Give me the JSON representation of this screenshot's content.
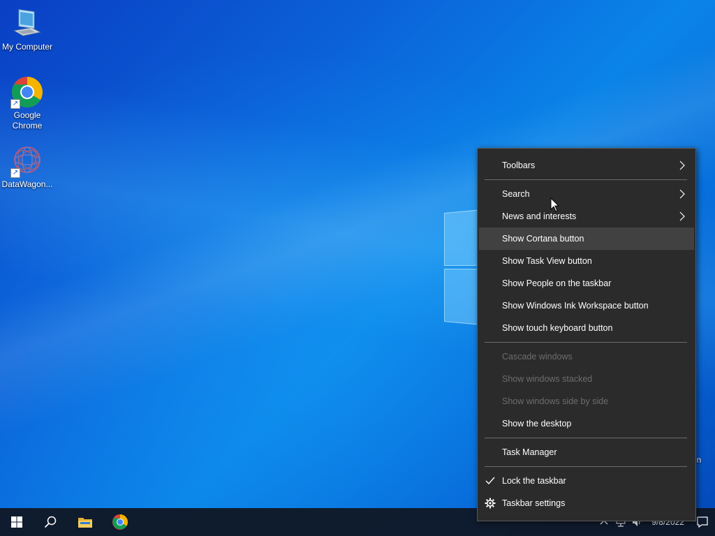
{
  "desktop": {
    "icons": [
      {
        "label": "My Computer",
        "icon": "computer-icon"
      },
      {
        "label": "Google Chrome",
        "icon": "chrome-icon"
      },
      {
        "label": "DataWagon...",
        "icon": "datawagon-icon"
      }
    ],
    "partial_text": "in"
  },
  "context_menu": {
    "items": [
      {
        "label": "Toolbars",
        "submenu": true
      },
      {
        "label": "Search",
        "submenu": true
      },
      {
        "label": "News and interests",
        "submenu": true
      },
      {
        "label": "Show Cortana button",
        "highlighted": true
      },
      {
        "label": "Show Task View button"
      },
      {
        "label": "Show People on the taskbar"
      },
      {
        "label": "Show Windows Ink Workspace button"
      },
      {
        "label": "Show touch keyboard button"
      },
      {
        "label": "Cascade windows",
        "disabled": true
      },
      {
        "label": "Show windows stacked",
        "disabled": true
      },
      {
        "label": "Show windows side by side",
        "disabled": true
      },
      {
        "label": "Show the desktop"
      },
      {
        "label": "Task Manager"
      },
      {
        "label": "Lock the taskbar",
        "checked": true
      },
      {
        "label": "Taskbar settings",
        "icon": "gear-icon"
      }
    ]
  },
  "taskbar": {
    "buttons": [
      "start-icon",
      "search-icon",
      "file-explorer-icon",
      "chrome-icon"
    ],
    "tray": {
      "date": "9/8/2022",
      "icons": [
        "chevron-up-icon",
        "network-icon",
        "volume-icon",
        "notification-icon"
      ]
    }
  },
  "colors": {
    "menu_bg": "#2b2b2b",
    "menu_highlight": "#414141",
    "taskbar_bg": "#101826",
    "disabled_text": "#6d6d6d"
  }
}
